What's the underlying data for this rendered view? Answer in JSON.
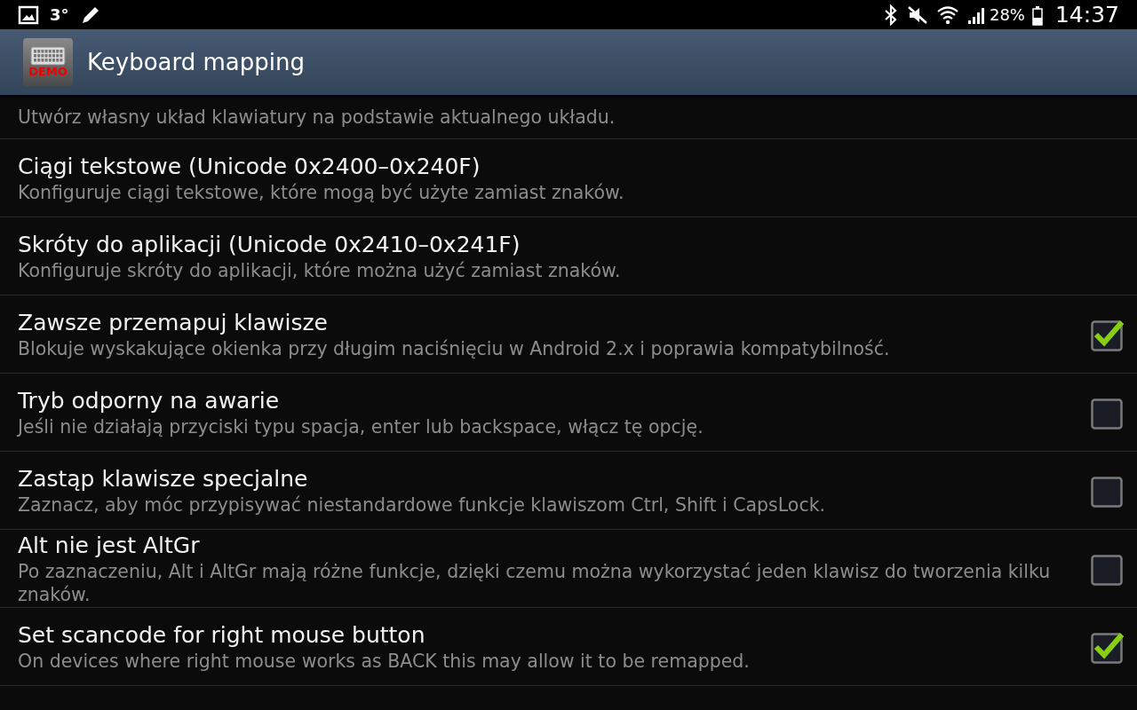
{
  "status_bar": {
    "temperature": "3°",
    "battery": "28%",
    "time": "14:37"
  },
  "app_bar": {
    "icon_label": "DEMO",
    "title": "Keyboard mapping"
  },
  "settings": [
    {
      "kind": "plain",
      "summary": "Utwórz własny układ klawiatury na podstawie aktualnego układu."
    },
    {
      "kind": "plain",
      "title": "Ciągi tekstowe (Unicode 0x2400–0x240F)",
      "summary": "Konfiguruje ciągi tekstowe, które mogą być użyte zamiast znaków."
    },
    {
      "kind": "plain",
      "title": "Skróty do aplikacji (Unicode 0x2410–0x241F)",
      "summary": "Konfiguruje skróty do aplikacji, które można użyć zamiast znaków."
    },
    {
      "kind": "checkbox",
      "title": "Zawsze przemapuj klawisze",
      "summary": "Blokuje wyskakujące okienka przy długim naciśnięciu w Android 2.x i poprawia kompatybilność.",
      "checked": true
    },
    {
      "kind": "checkbox",
      "title": "Tryb odporny na awarie",
      "summary": "Jeśli nie działają przyciski typu spacja, enter lub backspace, włącz tę opcję.",
      "checked": false
    },
    {
      "kind": "checkbox",
      "title": "Zastąp klawisze specjalne",
      "summary": "Zaznacz, aby móc przypisywać niestandardowe funkcje klawiszom Ctrl, Shift i CapsLock.",
      "checked": false
    },
    {
      "kind": "checkbox",
      "title": "Alt nie jest AltGr",
      "summary": "Po zaznaczeniu, Alt i AltGr mają różne funkcje, dzięki czemu można wykorzystać jeden klawisz do tworzenia kilku znaków.",
      "checked": false
    },
    {
      "kind": "checkbox",
      "title": "Set scancode for right mouse button",
      "summary": "On devices where right mouse works as BACK this may allow it to be remapped.",
      "checked": true
    }
  ]
}
